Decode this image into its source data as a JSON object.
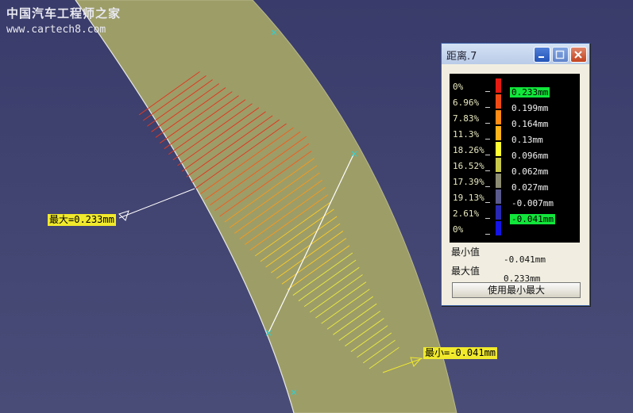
{
  "watermark": {
    "cn": "中国汽车工程师之家",
    "url": "www.cartech8.com"
  },
  "annotations": {
    "max_label": "最大=0.233mm",
    "min_label": "最小=-0.041mm"
  },
  "dialog": {
    "title": "距离.7",
    "controls": {
      "minimize": "minimize-icon",
      "maximize": "maximize-icon",
      "close": "close-icon"
    },
    "legend": [
      {
        "pct": "0%",
        "value": "0.233mm",
        "color": "#e51a12",
        "highlight": true
      },
      {
        "pct": "6.96%",
        "value": "0.199mm",
        "color": "#f04a14",
        "highlight": false
      },
      {
        "pct": "7.83%",
        "value": "0.164mm",
        "color": "#ff8a14",
        "highlight": false
      },
      {
        "pct": "11.3%",
        "value": "0.13mm",
        "color": "#ffb41a",
        "highlight": false
      },
      {
        "pct": "18.26%",
        "value": "0.096mm",
        "color": "#ffff30",
        "highlight": false
      },
      {
        "pct": "16.52%",
        "value": "0.062mm",
        "color": "#c8c84a",
        "highlight": false
      },
      {
        "pct": "17.39%",
        "value": "0.027mm",
        "color": "#8c8c74",
        "highlight": false
      },
      {
        "pct": "19.13%",
        "value": "-0.007mm",
        "color": "#5a5a8c",
        "highlight": false
      },
      {
        "pct": "2.61%",
        "value": "-0.041mm",
        "color": "#2828b4",
        "highlight": true
      },
      {
        "pct": "0%",
        "value": "",
        "color": "#1414e6",
        "highlight": false
      }
    ],
    "min_label": "最小值",
    "min_value": "-0.041mm",
    "max_label": "最大值",
    "max_value": "0.233mm",
    "button_label": "使用最小最大"
  }
}
